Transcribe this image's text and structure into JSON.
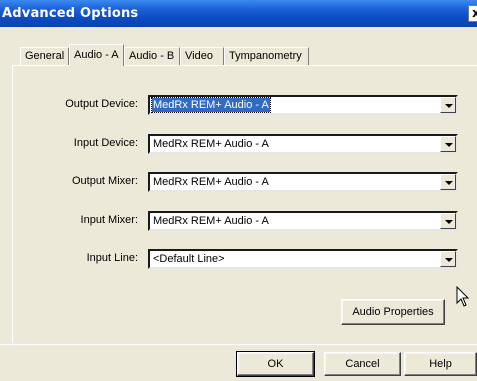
{
  "window": {
    "title": "Advanced Options",
    "close_label": "x"
  },
  "tabs": [
    {
      "label": "General",
      "active": false
    },
    {
      "label": "Audio - A",
      "active": true
    },
    {
      "label": "Audio - B",
      "active": false
    },
    {
      "label": "Video",
      "active": false
    },
    {
      "label": "Tympanometry",
      "active": false
    }
  ],
  "fields": [
    {
      "label": "Output Device:",
      "value": "MedRx REM+ Audio - A",
      "selected": true
    },
    {
      "label": "Input Device:",
      "value": "MedRx REM+ Audio - A",
      "selected": false
    },
    {
      "label": "Output Mixer:",
      "value": "MedRx REM+ Audio - A",
      "selected": false
    },
    {
      "label": "Input Mixer:",
      "value": "MedRx REM+ Audio - A",
      "selected": false
    },
    {
      "label": "Input Line:",
      "value": "<Default Line>",
      "selected": false
    }
  ],
  "buttons": {
    "audio_properties": "Audio Properties",
    "ok": "OK",
    "cancel": "Cancel",
    "help": "Help"
  },
  "colors": {
    "title_bar": "#0a4bc0",
    "dialog_bg": "#ece9d8",
    "selection": "#316ac5"
  }
}
